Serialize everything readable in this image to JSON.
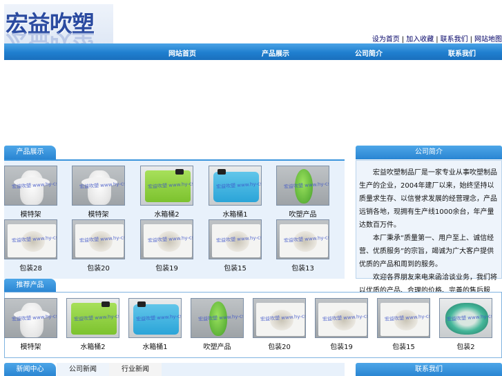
{
  "logo": {
    "text": "宏益吹塑"
  },
  "toplinks": [
    "设为首页",
    "加入收藏",
    "联系我们",
    "网站地图"
  ],
  "nav": [
    "网站首页",
    "产品展示",
    "公司简介",
    "联系我们"
  ],
  "section1": {
    "title": "产品展示",
    "products": [
      {
        "name": "模特架",
        "kind": "torso"
      },
      {
        "name": "模特架",
        "kind": "torso"
      },
      {
        "name": "水箱桶2",
        "kind": "tank-green"
      },
      {
        "name": "水箱桶1",
        "kind": "tank-blue"
      },
      {
        "name": "吹塑产品",
        "kind": "egg"
      },
      {
        "name": "包装28",
        "kind": "foam"
      },
      {
        "name": "包装20",
        "kind": "foam"
      },
      {
        "name": "包装19",
        "kind": "foam"
      },
      {
        "name": "包装15",
        "kind": "foam"
      },
      {
        "name": "包装13",
        "kind": "foam"
      }
    ]
  },
  "about": {
    "title": "公司简介",
    "paragraphs": [
      "宏益吹塑制品厂是一家专业从事吹塑制品生产的企业，2004年建厂以来，始终坚持以质量求生存、以信誉求发展的经营理念，产品远销各地，现拥有生产线1000余台，年产量达数百万件。",
      "本厂秉承“质量第一、用户至上、诚信经营、优质服务”的宗旨，竭诚为广大客户提供优质的产品和周到的服务。",
      "欢迎各界朋友来电来函洽谈业务，我们将以优质的产品、合理的价格、完善的售后服务，与您携手共创美好未来。期待您的光临！"
    ]
  },
  "section2": {
    "title": "推荐产品",
    "products": [
      {
        "name": "模特架",
        "kind": "torso"
      },
      {
        "name": "水箱桶2",
        "kind": "tank-green"
      },
      {
        "name": "水箱桶1",
        "kind": "tank-blue"
      },
      {
        "name": "吹塑产品",
        "kind": "egg"
      },
      {
        "name": "包装20",
        "kind": "foam"
      },
      {
        "name": "包装19",
        "kind": "foam"
      },
      {
        "name": "包装15",
        "kind": "foam"
      },
      {
        "name": "包装2",
        "kind": "ring"
      }
    ]
  },
  "bottom": {
    "left_tab": "新闻中心",
    "subtabs": [
      "公司新闻",
      "行业新闻"
    ],
    "right_tab": "联系我们"
  },
  "watermark": "宏益吹塑 www.hy-cs.com"
}
